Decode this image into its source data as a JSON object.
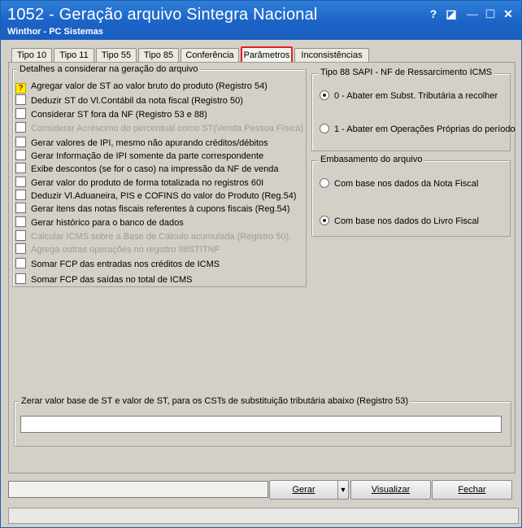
{
  "window": {
    "title": "1052 - Geração arquivo Sintegra Nacional",
    "subtitle": "Winthor - PC Sistemas",
    "controls": {
      "help": "?",
      "edit": "◪",
      "minimize": "—",
      "maximize": "☐",
      "close": "✕"
    }
  },
  "tabs": [
    {
      "label": "Tipo 10"
    },
    {
      "label": "Tipo 11"
    },
    {
      "label": "Tipo 55"
    },
    {
      "label": "Tipo 85"
    },
    {
      "label": "Conferência"
    },
    {
      "label": "Parâmetros"
    },
    {
      "label": "Inconsistências"
    }
  ],
  "detalhes": {
    "legend": "Detalhes a considerar na geração do arquivo",
    "items": [
      {
        "label": "Agregar valor de ST ao valor bruto do produto (Registro 54)",
        "enabled": true
      },
      {
        "label": "Deduzir ST do Vl.Contábil da nota fiscal (Registro 50)",
        "enabled": true
      },
      {
        "label": "Considerar ST fora da NF (Registro 53 e 88)",
        "enabled": true
      },
      {
        "label": "Considerar Acréscimo do percentual como ST(Venda Pessoa Física)",
        "enabled": false
      },
      {
        "label": "Gerar valores de IPI, mesmo não apurando créditos/débitos",
        "enabled": true
      },
      {
        "label": "Gerar Informação de IPI somente da parte correspondente",
        "enabled": true
      },
      {
        "label": "Exibe descontos (se for o caso) na impressão da NF de venda",
        "enabled": true
      },
      {
        "label": "Gerar valor do produto de forma totalizada no registros 60I",
        "enabled": true
      },
      {
        "label": "Deduzir Vl.Aduaneira, PIS e COFINS do valor do Produto (Reg.54)",
        "enabled": true
      },
      {
        "label": "Gerar itens das notas fiscais referentes à cupons fiscais (Reg.54)",
        "enabled": true
      },
      {
        "label": "Gerar histórico para o banco de dados",
        "enabled": true
      },
      {
        "label": "Calcular ICMS sobre a Base de Cálculo acumulada (Registro 50).",
        "enabled": false
      },
      {
        "label": "Agrega outras operações no registro 88STITNF",
        "enabled": false
      },
      {
        "label": "Somar FCP das entradas nos créditos de ICMS",
        "enabled": true
      },
      {
        "label": "Somar FCP das saídas no total de ICMS",
        "enabled": true
      }
    ]
  },
  "tipo88": {
    "legend": "Tipo 88  SAPI - NF de Ressarcimento ICMS",
    "options": [
      {
        "label": "0 - Abater em Subst. Tributária a recolher",
        "selected": true
      },
      {
        "label": "1 - Abater em Operações Próprias do período",
        "selected": false
      }
    ]
  },
  "embasamento": {
    "legend": "Embasamento do arquivo",
    "options": [
      {
        "label": "Com base nos dados da Nota Fiscal",
        "selected": false
      },
      {
        "label": "Com base nos dados do Livro Fiscal",
        "selected": true
      }
    ]
  },
  "zerar": {
    "legend": "Zerar valor base de ST e valor de ST, para os CSTs de substituição tributária abaixo (Registro 53)",
    "value": ""
  },
  "footer": {
    "status_value": "",
    "gerar": "Gerar",
    "visualizar": "Visualizar",
    "fechar": "Fechar"
  },
  "colors": {
    "titlebar": "#1b63c6",
    "active_tab_border": "#e02020",
    "help_icon_bg": "#ffee00"
  }
}
